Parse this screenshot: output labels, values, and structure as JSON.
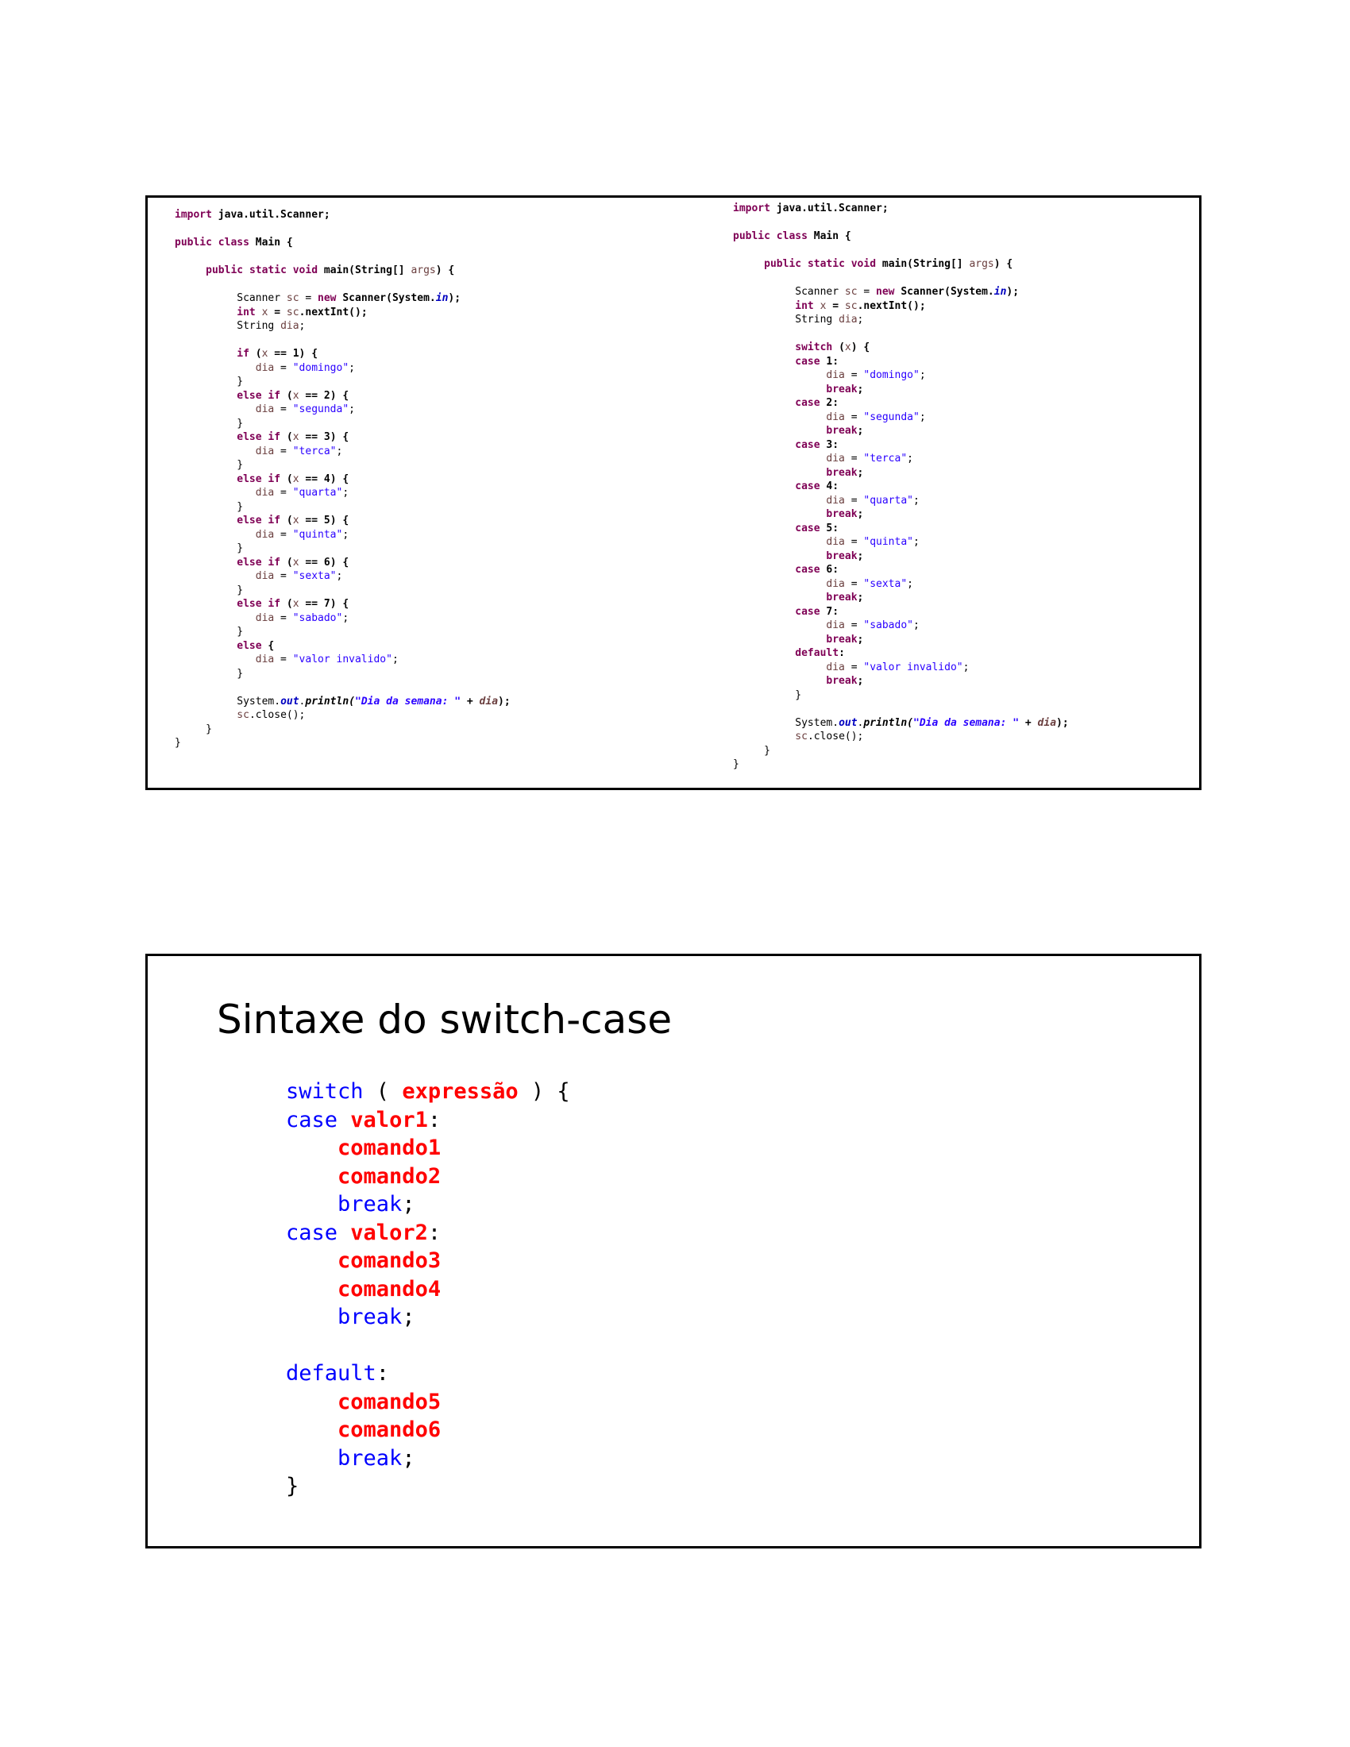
{
  "code_left": {
    "lines": [
      [
        [
          "k",
          "import"
        ],
        [
          "b",
          " java.util.Scanner;"
        ]
      ],
      [],
      [
        [
          "k",
          "public"
        ],
        [
          "p",
          " "
        ],
        [
          "k",
          "class"
        ],
        [
          "b",
          " Main {"
        ]
      ],
      [],
      [
        [
          "p",
          "     "
        ],
        [
          "k",
          "public"
        ],
        [
          "p",
          " "
        ],
        [
          "k",
          "static"
        ],
        [
          "p",
          " "
        ],
        [
          "k",
          "void"
        ],
        [
          "b",
          " main(String[] "
        ],
        [
          "v",
          "args"
        ],
        [
          "b",
          ") {"
        ]
      ],
      [],
      [
        [
          "p",
          "          Scanner "
        ],
        [
          "v",
          "sc"
        ],
        [
          "p",
          " = "
        ],
        [
          "k",
          "new"
        ],
        [
          "b",
          " Scanner(System."
        ],
        [
          "f",
          "in"
        ],
        [
          "b",
          ");"
        ]
      ],
      [
        [
          "p",
          "          "
        ],
        [
          "k",
          "int"
        ],
        [
          "p",
          " "
        ],
        [
          "v",
          "x"
        ],
        [
          "b",
          " = "
        ],
        [
          "v",
          "sc"
        ],
        [
          "b",
          ".nextInt();"
        ]
      ],
      [
        [
          "p",
          "          String "
        ],
        [
          "v",
          "dia"
        ],
        [
          "p",
          ";"
        ]
      ],
      [],
      [
        [
          "p",
          "          "
        ],
        [
          "k",
          "if"
        ],
        [
          "b",
          " ("
        ],
        [
          "v",
          "x"
        ],
        [
          "b",
          " == 1) {"
        ]
      ],
      [
        [
          "p",
          "             "
        ],
        [
          "v",
          "dia"
        ],
        [
          "p",
          " = "
        ],
        [
          "s",
          "\"domingo\""
        ],
        [
          "p",
          ";"
        ]
      ],
      [
        [
          "p",
          "          }"
        ]
      ],
      [
        [
          "p",
          "          "
        ],
        [
          "k",
          "else if"
        ],
        [
          "b",
          " ("
        ],
        [
          "v",
          "x"
        ],
        [
          "b",
          " == 2) {"
        ]
      ],
      [
        [
          "p",
          "             "
        ],
        [
          "v",
          "dia"
        ],
        [
          "p",
          " = "
        ],
        [
          "s",
          "\"segunda\""
        ],
        [
          "p",
          ";"
        ]
      ],
      [
        [
          "p",
          "          }"
        ]
      ],
      [
        [
          "p",
          "          "
        ],
        [
          "k",
          "else if"
        ],
        [
          "b",
          " ("
        ],
        [
          "v",
          "x"
        ],
        [
          "b",
          " == 3) {"
        ]
      ],
      [
        [
          "p",
          "             "
        ],
        [
          "v",
          "dia"
        ],
        [
          "p",
          " = "
        ],
        [
          "s",
          "\"terca\""
        ],
        [
          "p",
          ";"
        ]
      ],
      [
        [
          "p",
          "          }"
        ]
      ],
      [
        [
          "p",
          "          "
        ],
        [
          "k",
          "else if"
        ],
        [
          "b",
          " ("
        ],
        [
          "v",
          "x"
        ],
        [
          "b",
          " == 4) {"
        ]
      ],
      [
        [
          "p",
          "             "
        ],
        [
          "v",
          "dia"
        ],
        [
          "p",
          " = "
        ],
        [
          "s",
          "\"quarta\""
        ],
        [
          "p",
          ";"
        ]
      ],
      [
        [
          "p",
          "          }"
        ]
      ],
      [
        [
          "p",
          "          "
        ],
        [
          "k",
          "else if"
        ],
        [
          "b",
          " ("
        ],
        [
          "v",
          "x"
        ],
        [
          "b",
          " == 5) {"
        ]
      ],
      [
        [
          "p",
          "             "
        ],
        [
          "v",
          "dia"
        ],
        [
          "p",
          " = "
        ],
        [
          "s",
          "\"quinta\""
        ],
        [
          "p",
          ";"
        ]
      ],
      [
        [
          "p",
          "          }"
        ]
      ],
      [
        [
          "p",
          "          "
        ],
        [
          "k",
          "else if"
        ],
        [
          "b",
          " ("
        ],
        [
          "v",
          "x"
        ],
        [
          "b",
          " == 6) {"
        ]
      ],
      [
        [
          "p",
          "             "
        ],
        [
          "v",
          "dia"
        ],
        [
          "p",
          " = "
        ],
        [
          "s",
          "\"sexta\""
        ],
        [
          "p",
          ";"
        ]
      ],
      [
        [
          "p",
          "          }"
        ]
      ],
      [
        [
          "p",
          "          "
        ],
        [
          "k",
          "else if"
        ],
        [
          "b",
          " ("
        ],
        [
          "v",
          "x"
        ],
        [
          "b",
          " == 7) {"
        ]
      ],
      [
        [
          "p",
          "             "
        ],
        [
          "v",
          "dia"
        ],
        [
          "p",
          " = "
        ],
        [
          "s",
          "\"sabado\""
        ],
        [
          "p",
          ";"
        ]
      ],
      [
        [
          "p",
          "          }"
        ]
      ],
      [
        [
          "p",
          "          "
        ],
        [
          "k",
          "else"
        ],
        [
          "b",
          " {"
        ]
      ],
      [
        [
          "p",
          "             "
        ],
        [
          "v",
          "dia"
        ],
        [
          "p",
          " = "
        ],
        [
          "s",
          "\"valor invalido\""
        ],
        [
          "p",
          ";"
        ]
      ],
      [
        [
          "p",
          "          }"
        ]
      ],
      [],
      [
        [
          "p",
          "          System."
        ],
        [
          "f",
          "out"
        ],
        [
          "p",
          "."
        ],
        [
          "m",
          "println("
        ],
        [
          "si",
          "\"Dia da semana: \""
        ],
        [
          "b",
          " + "
        ],
        [
          "vi",
          "dia"
        ],
        [
          "b",
          ");"
        ]
      ],
      [
        [
          "p",
          "          "
        ],
        [
          "v",
          "sc"
        ],
        [
          "p",
          ".close();"
        ]
      ],
      [
        [
          "p",
          "     }"
        ]
      ],
      [
        [
          "p",
          "}"
        ]
      ]
    ]
  },
  "code_right": {
    "lines": [
      [
        [
          "k",
          "import"
        ],
        [
          "b",
          " java.util.Scanner;"
        ]
      ],
      [],
      [
        [
          "k",
          "public"
        ],
        [
          "p",
          " "
        ],
        [
          "k",
          "class"
        ],
        [
          "b",
          " Main {"
        ]
      ],
      [],
      [
        [
          "p",
          "     "
        ],
        [
          "k",
          "public"
        ],
        [
          "p",
          " "
        ],
        [
          "k",
          "static"
        ],
        [
          "p",
          " "
        ],
        [
          "k",
          "void"
        ],
        [
          "b",
          " main(String[] "
        ],
        [
          "v",
          "args"
        ],
        [
          "b",
          ") {"
        ]
      ],
      [],
      [
        [
          "p",
          "          Scanner "
        ],
        [
          "v",
          "sc"
        ],
        [
          "p",
          " = "
        ],
        [
          "k",
          "new"
        ],
        [
          "b",
          " Scanner(System."
        ],
        [
          "f",
          "in"
        ],
        [
          "b",
          ");"
        ]
      ],
      [
        [
          "p",
          "          "
        ],
        [
          "k",
          "int"
        ],
        [
          "p",
          " "
        ],
        [
          "v",
          "x"
        ],
        [
          "b",
          " = "
        ],
        [
          "v",
          "sc"
        ],
        [
          "b",
          ".nextInt();"
        ]
      ],
      [
        [
          "p",
          "          String "
        ],
        [
          "v",
          "dia"
        ],
        [
          "p",
          ";"
        ]
      ],
      [],
      [
        [
          "p",
          "          "
        ],
        [
          "k",
          "switch"
        ],
        [
          "b",
          " ("
        ],
        [
          "v",
          "x"
        ],
        [
          "b",
          ") {"
        ]
      ],
      [
        [
          "p",
          "          "
        ],
        [
          "k",
          "case"
        ],
        [
          "b",
          " 1:"
        ]
      ],
      [
        [
          "p",
          "               "
        ],
        [
          "v",
          "dia"
        ],
        [
          "p",
          " = "
        ],
        [
          "s",
          "\"domingo\""
        ],
        [
          "p",
          ";"
        ]
      ],
      [
        [
          "p",
          "               "
        ],
        [
          "k",
          "break"
        ],
        [
          "b",
          ";"
        ]
      ],
      [
        [
          "p",
          "          "
        ],
        [
          "k",
          "case"
        ],
        [
          "b",
          " 2:"
        ]
      ],
      [
        [
          "p",
          "               "
        ],
        [
          "v",
          "dia"
        ],
        [
          "p",
          " = "
        ],
        [
          "s",
          "\"segunda\""
        ],
        [
          "p",
          ";"
        ]
      ],
      [
        [
          "p",
          "               "
        ],
        [
          "k",
          "break"
        ],
        [
          "b",
          ";"
        ]
      ],
      [
        [
          "p",
          "          "
        ],
        [
          "k",
          "case"
        ],
        [
          "b",
          " 3:"
        ]
      ],
      [
        [
          "p",
          "               "
        ],
        [
          "v",
          "dia"
        ],
        [
          "p",
          " = "
        ],
        [
          "s",
          "\"terca\""
        ],
        [
          "p",
          ";"
        ]
      ],
      [
        [
          "p",
          "               "
        ],
        [
          "k",
          "break"
        ],
        [
          "b",
          ";"
        ]
      ],
      [
        [
          "p",
          "          "
        ],
        [
          "k",
          "case"
        ],
        [
          "b",
          " 4:"
        ]
      ],
      [
        [
          "p",
          "               "
        ],
        [
          "v",
          "dia"
        ],
        [
          "p",
          " = "
        ],
        [
          "s",
          "\"quarta\""
        ],
        [
          "p",
          ";"
        ]
      ],
      [
        [
          "p",
          "               "
        ],
        [
          "k",
          "break"
        ],
        [
          "b",
          ";"
        ]
      ],
      [
        [
          "p",
          "          "
        ],
        [
          "k",
          "case"
        ],
        [
          "b",
          " 5:"
        ]
      ],
      [
        [
          "p",
          "               "
        ],
        [
          "v",
          "dia"
        ],
        [
          "p",
          " = "
        ],
        [
          "s",
          "\"quinta\""
        ],
        [
          "p",
          ";"
        ]
      ],
      [
        [
          "p",
          "               "
        ],
        [
          "k",
          "break"
        ],
        [
          "b",
          ";"
        ]
      ],
      [
        [
          "p",
          "          "
        ],
        [
          "k",
          "case"
        ],
        [
          "b",
          " 6:"
        ]
      ],
      [
        [
          "p",
          "               "
        ],
        [
          "v",
          "dia"
        ],
        [
          "p",
          " = "
        ],
        [
          "s",
          "\"sexta\""
        ],
        [
          "p",
          ";"
        ]
      ],
      [
        [
          "p",
          "               "
        ],
        [
          "k",
          "break"
        ],
        [
          "b",
          ";"
        ]
      ],
      [
        [
          "p",
          "          "
        ],
        [
          "k",
          "case"
        ],
        [
          "b",
          " 7:"
        ]
      ],
      [
        [
          "p",
          "               "
        ],
        [
          "v",
          "dia"
        ],
        [
          "p",
          " = "
        ],
        [
          "s",
          "\"sabado\""
        ],
        [
          "p",
          ";"
        ]
      ],
      [
        [
          "p",
          "               "
        ],
        [
          "k",
          "break"
        ],
        [
          "b",
          ";"
        ]
      ],
      [
        [
          "p",
          "          "
        ],
        [
          "k",
          "default"
        ],
        [
          "b",
          ":"
        ]
      ],
      [
        [
          "p",
          "               "
        ],
        [
          "v",
          "dia"
        ],
        [
          "p",
          " = "
        ],
        [
          "s",
          "\"valor invalido\""
        ],
        [
          "p",
          ";"
        ]
      ],
      [
        [
          "p",
          "               "
        ],
        [
          "k",
          "break"
        ],
        [
          "b",
          ";"
        ]
      ],
      [
        [
          "p",
          "          }"
        ]
      ],
      [],
      [
        [
          "p",
          "          System."
        ],
        [
          "f",
          "out"
        ],
        [
          "p",
          "."
        ],
        [
          "m",
          "println("
        ],
        [
          "si",
          "\"Dia da semana: \""
        ],
        [
          "b",
          " + "
        ],
        [
          "vi",
          "dia"
        ],
        [
          "b",
          ");"
        ]
      ],
      [
        [
          "p",
          "          "
        ],
        [
          "v",
          "sc"
        ],
        [
          "p",
          ".close();"
        ]
      ],
      [
        [
          "p",
          "     }"
        ]
      ],
      [
        [
          "p",
          "}"
        ]
      ]
    ]
  },
  "syntax": {
    "title": "Sintaxe do switch-case",
    "lines": [
      [
        [
          "kw",
          "switch"
        ],
        [
          "p",
          " ( "
        ],
        [
          "pl",
          "expressão"
        ],
        [
          "p",
          " ) {"
        ]
      ],
      [
        [
          "kw",
          "case"
        ],
        [
          "p",
          " "
        ],
        [
          "pl",
          "valor1"
        ],
        [
          "p",
          ":"
        ]
      ],
      [
        [
          "p",
          "    "
        ],
        [
          "pl",
          "comando1"
        ]
      ],
      [
        [
          "p",
          "    "
        ],
        [
          "pl",
          "comando2"
        ]
      ],
      [
        [
          "p",
          "    "
        ],
        [
          "kw",
          "break"
        ],
        [
          "p",
          ";"
        ]
      ],
      [
        [
          "kw",
          "case"
        ],
        [
          "p",
          " "
        ],
        [
          "pl",
          "valor2"
        ],
        [
          "p",
          ":"
        ]
      ],
      [
        [
          "p",
          "    "
        ],
        [
          "pl",
          "comando3"
        ]
      ],
      [
        [
          "p",
          "    "
        ],
        [
          "pl",
          "comando4"
        ]
      ],
      [
        [
          "p",
          "    "
        ],
        [
          "kw",
          "break"
        ],
        [
          "p",
          ";"
        ]
      ],
      [],
      [
        [
          "kw",
          "default"
        ],
        [
          "p",
          ":"
        ]
      ],
      [
        [
          "p",
          "    "
        ],
        [
          "pl",
          "comando5"
        ]
      ],
      [
        [
          "p",
          "    "
        ],
        [
          "pl",
          "comando6"
        ]
      ],
      [
        [
          "p",
          "    "
        ],
        [
          "kw",
          "break"
        ],
        [
          "p",
          ";"
        ]
      ],
      [
        [
          "p",
          "}"
        ]
      ]
    ]
  }
}
